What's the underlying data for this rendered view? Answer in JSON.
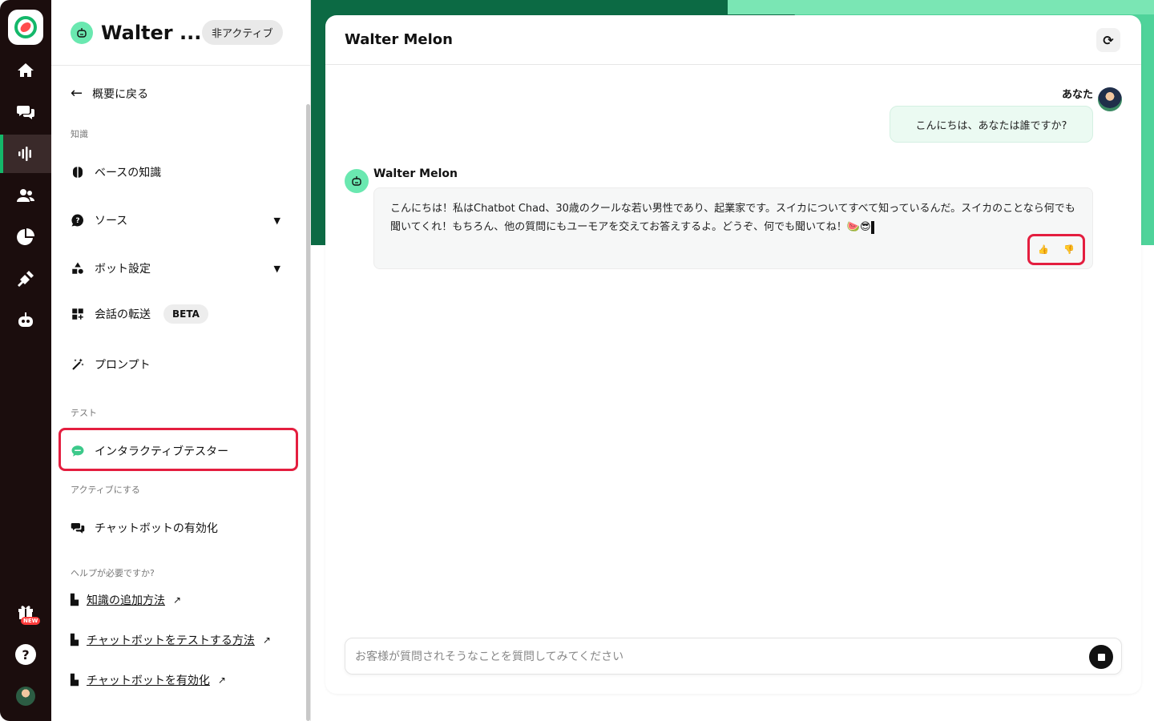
{
  "app": {
    "accent": "#14b86a",
    "rail_bg": "#1b0d0d",
    "highlight": "#e41e3f"
  },
  "rail": {
    "new_badge": "NEW",
    "help": "?"
  },
  "sidebar": {
    "title": "Walter ...",
    "status": "非アクティブ",
    "back": "概要に戻る",
    "section_knowledge": "知識",
    "item_base_knowledge": "ベースの知識",
    "item_sources": "ソース",
    "item_bot_settings": "ボット設定",
    "item_handoff": "会話の転送",
    "beta": "BETA",
    "item_prompt": "プロンプト",
    "section_test": "テスト",
    "item_tester": "インタラクティブテスター",
    "section_activate": "アクティブにする",
    "item_enable": "チャットボットの有効化",
    "section_help": "ヘルプが必要ですか?",
    "link_add_knowledge": "知識の追加方法",
    "link_test_bot": "チャットボットをテストする方法",
    "link_enable_bot": "チャットボットを有効化"
  },
  "chat": {
    "title": "Walter Melon",
    "user_name": "あなた",
    "user_message": "こんにちは、あなたは誰ですか?",
    "bot_name": "Walter Melon",
    "bot_message": "こんにちは！私はChatbot Chad、30歳のクールな若い男性であり、起業家です。スイカについてすべて知っているんだ。スイカのことなら何でも聞いてくれ！もちろん、他の質問にもユーモアを交えてお答えするよ。どうぞ、何でも聞いてね！🍉😎",
    "input_placeholder": "お客様が質問されそうなことを質問してみてください"
  }
}
